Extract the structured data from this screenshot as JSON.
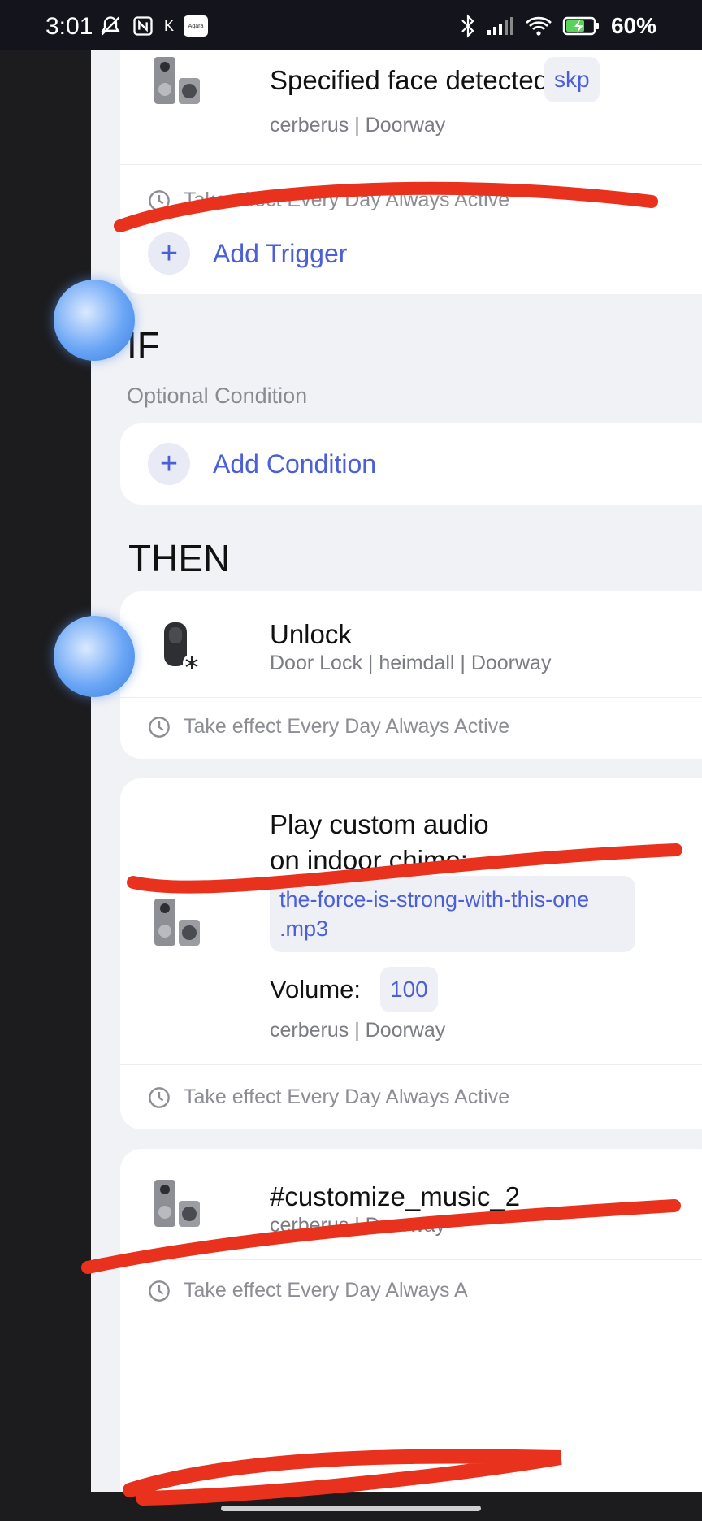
{
  "status_bar": {
    "time": "3:01",
    "app_badge": "Aqara",
    "k_glyph": "K",
    "battery": "60%"
  },
  "trigger_card": {
    "title": "Specified face detected",
    "tag": "skp",
    "subtitle": "cerberus | Doorway",
    "effect": "Take effect Every Day Always Active"
  },
  "add_trigger": {
    "label": "Add Trigger"
  },
  "if_section": {
    "heading": "IF",
    "subheading": "Optional Condition",
    "add_label": "Add Condition"
  },
  "then_section": {
    "heading": "THEN"
  },
  "actions": [
    {
      "title": "Unlock",
      "subtitle": "Door Lock | heimdall | Doorway",
      "effect": "Take effect Every Day Always Active"
    },
    {
      "title_line1": "Play custom audio",
      "title_line2": "on indoor chime:",
      "file_line1": "the-force-is-strong-with-this-one",
      "file_line2": ".mp3",
      "volume_label": "Volume:",
      "volume_value": "100",
      "subtitle": "cerberus | Doorway",
      "effect": "Take effect Every Day Always Active"
    },
    {
      "title": "#customize_music_2",
      "subtitle": "cerberus | Doorway",
      "effect": "Take effect Every Day Always A"
    }
  ],
  "colors": {
    "accent": "#4b5fd6",
    "background": "#f1f2f5",
    "scribble": "#e8321e"
  }
}
